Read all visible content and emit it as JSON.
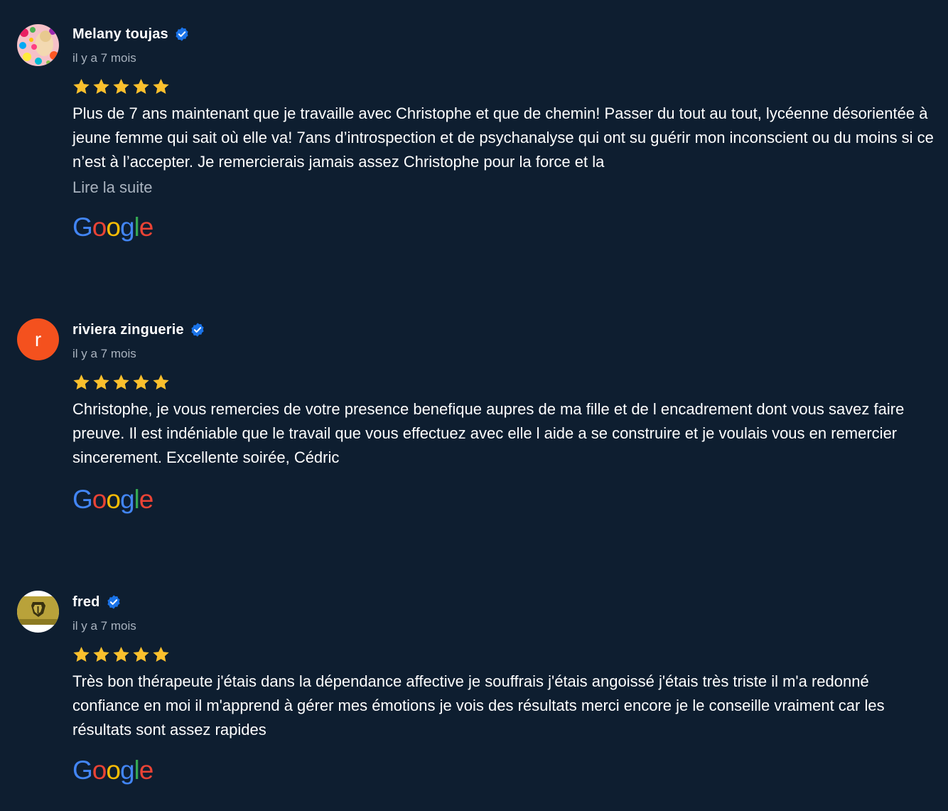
{
  "colors": {
    "background": "#0e1e30",
    "star": "#fbc02d",
    "verified": "#1a73e8",
    "secondary_text": "#a9b3bf"
  },
  "reviews": [
    {
      "author": "Melany toujas",
      "verified_icon": "verified-badge-icon",
      "date": "il y a 7 mois",
      "rating": 5,
      "text": "Plus de 7 ans maintenant que je travaille avec Christophe et que de chemin! Passer du tout au tout, lycéenne désorientée à jeune femme qui sait où elle va! 7ans d’introspection et de psychanalyse qui ont su guérir mon inconscient ou du moins si ce n’est à l’accepter. Je remercierais jamais assez Christophe pour la force et la",
      "read_more": "Lire la suite",
      "source_logo": "Google"
    },
    {
      "author": "riviera zinguerie",
      "avatar_letter": "r",
      "verified_icon": "verified-badge-icon",
      "date": "il y a 7 mois",
      "rating": 5,
      "text": "Christophe, je vous remercies de votre presence benefique aupres de ma fille et de l encadrement dont vous savez faire preuve. Il est indéniable que le travail que vous effectuez avec elle l aide a se construire et je voulais vous en remercier sincerement. Excellente soirée, Cédric",
      "source_logo": "Google"
    },
    {
      "author": "fred",
      "verified_icon": "verified-badge-icon",
      "date": "il y a 7 mois",
      "rating": 5,
      "text": "Très bon thérapeute j'étais dans la dépendance affective je souffrais j'étais angoissé j'étais très triste il m'a redonné confiance en moi il m'apprend à gérer mes émotions je vois des résultats merci encore je le conseille vraiment car les résultats sont assez rapides",
      "source_logo": "Google"
    }
  ]
}
